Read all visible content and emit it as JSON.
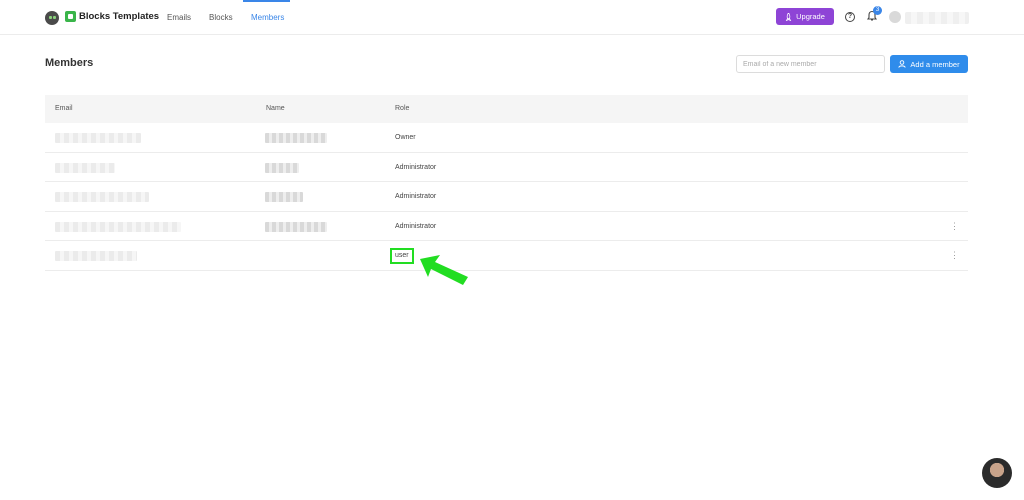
{
  "app": {
    "brand": "Blocks Templates"
  },
  "nav": {
    "tabs": [
      {
        "label": "Emails"
      },
      {
        "label": "Blocks"
      },
      {
        "label": "Members"
      }
    ],
    "upgrade_label": "Upgrade",
    "help_icon": "question-circle-icon",
    "notifications_count": "3"
  },
  "page": {
    "title": "Members",
    "new_member_placeholder": "Email of a new member",
    "add_member_label": "Add a member"
  },
  "table": {
    "columns": [
      "Email",
      "Name",
      "Role"
    ],
    "rows": [
      {
        "role": "Owner"
      },
      {
        "role": "Administrator"
      },
      {
        "role": "Administrator"
      },
      {
        "role": "Administrator"
      },
      {
        "role": "user"
      }
    ]
  },
  "colors": {
    "accent": "#2f8ceb",
    "upgrade": "#8e44d6",
    "highlight": "#22dd22"
  }
}
